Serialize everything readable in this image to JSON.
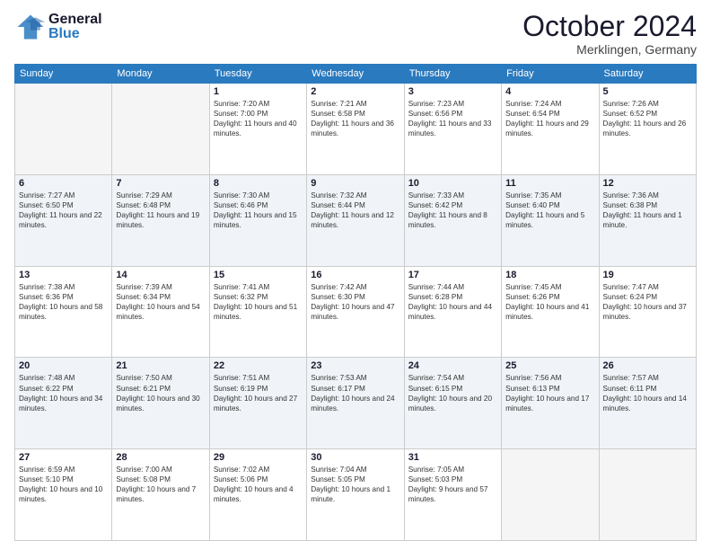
{
  "header": {
    "logo_general": "General",
    "logo_blue": "Blue",
    "month": "October 2024",
    "location": "Merklingen, Germany"
  },
  "weekdays": [
    "Sunday",
    "Monday",
    "Tuesday",
    "Wednesday",
    "Thursday",
    "Friday",
    "Saturday"
  ],
  "weeks": [
    [
      {
        "day": "",
        "sunrise": "",
        "sunset": "",
        "daylight": ""
      },
      {
        "day": "",
        "sunrise": "",
        "sunset": "",
        "daylight": ""
      },
      {
        "day": "1",
        "sunrise": "Sunrise: 7:20 AM",
        "sunset": "Sunset: 7:00 PM",
        "daylight": "Daylight: 11 hours and 40 minutes."
      },
      {
        "day": "2",
        "sunrise": "Sunrise: 7:21 AM",
        "sunset": "Sunset: 6:58 PM",
        "daylight": "Daylight: 11 hours and 36 minutes."
      },
      {
        "day": "3",
        "sunrise": "Sunrise: 7:23 AM",
        "sunset": "Sunset: 6:56 PM",
        "daylight": "Daylight: 11 hours and 33 minutes."
      },
      {
        "day": "4",
        "sunrise": "Sunrise: 7:24 AM",
        "sunset": "Sunset: 6:54 PM",
        "daylight": "Daylight: 11 hours and 29 minutes."
      },
      {
        "day": "5",
        "sunrise": "Sunrise: 7:26 AM",
        "sunset": "Sunset: 6:52 PM",
        "daylight": "Daylight: 11 hours and 26 minutes."
      }
    ],
    [
      {
        "day": "6",
        "sunrise": "Sunrise: 7:27 AM",
        "sunset": "Sunset: 6:50 PM",
        "daylight": "Daylight: 11 hours and 22 minutes."
      },
      {
        "day": "7",
        "sunrise": "Sunrise: 7:29 AM",
        "sunset": "Sunset: 6:48 PM",
        "daylight": "Daylight: 11 hours and 19 minutes."
      },
      {
        "day": "8",
        "sunrise": "Sunrise: 7:30 AM",
        "sunset": "Sunset: 6:46 PM",
        "daylight": "Daylight: 11 hours and 15 minutes."
      },
      {
        "day": "9",
        "sunrise": "Sunrise: 7:32 AM",
        "sunset": "Sunset: 6:44 PM",
        "daylight": "Daylight: 11 hours and 12 minutes."
      },
      {
        "day": "10",
        "sunrise": "Sunrise: 7:33 AM",
        "sunset": "Sunset: 6:42 PM",
        "daylight": "Daylight: 11 hours and 8 minutes."
      },
      {
        "day": "11",
        "sunrise": "Sunrise: 7:35 AM",
        "sunset": "Sunset: 6:40 PM",
        "daylight": "Daylight: 11 hours and 5 minutes."
      },
      {
        "day": "12",
        "sunrise": "Sunrise: 7:36 AM",
        "sunset": "Sunset: 6:38 PM",
        "daylight": "Daylight: 11 hours and 1 minute."
      }
    ],
    [
      {
        "day": "13",
        "sunrise": "Sunrise: 7:38 AM",
        "sunset": "Sunset: 6:36 PM",
        "daylight": "Daylight: 10 hours and 58 minutes."
      },
      {
        "day": "14",
        "sunrise": "Sunrise: 7:39 AM",
        "sunset": "Sunset: 6:34 PM",
        "daylight": "Daylight: 10 hours and 54 minutes."
      },
      {
        "day": "15",
        "sunrise": "Sunrise: 7:41 AM",
        "sunset": "Sunset: 6:32 PM",
        "daylight": "Daylight: 10 hours and 51 minutes."
      },
      {
        "day": "16",
        "sunrise": "Sunrise: 7:42 AM",
        "sunset": "Sunset: 6:30 PM",
        "daylight": "Daylight: 10 hours and 47 minutes."
      },
      {
        "day": "17",
        "sunrise": "Sunrise: 7:44 AM",
        "sunset": "Sunset: 6:28 PM",
        "daylight": "Daylight: 10 hours and 44 minutes."
      },
      {
        "day": "18",
        "sunrise": "Sunrise: 7:45 AM",
        "sunset": "Sunset: 6:26 PM",
        "daylight": "Daylight: 10 hours and 41 minutes."
      },
      {
        "day": "19",
        "sunrise": "Sunrise: 7:47 AM",
        "sunset": "Sunset: 6:24 PM",
        "daylight": "Daylight: 10 hours and 37 minutes."
      }
    ],
    [
      {
        "day": "20",
        "sunrise": "Sunrise: 7:48 AM",
        "sunset": "Sunset: 6:22 PM",
        "daylight": "Daylight: 10 hours and 34 minutes."
      },
      {
        "day": "21",
        "sunrise": "Sunrise: 7:50 AM",
        "sunset": "Sunset: 6:21 PM",
        "daylight": "Daylight: 10 hours and 30 minutes."
      },
      {
        "day": "22",
        "sunrise": "Sunrise: 7:51 AM",
        "sunset": "Sunset: 6:19 PM",
        "daylight": "Daylight: 10 hours and 27 minutes."
      },
      {
        "day": "23",
        "sunrise": "Sunrise: 7:53 AM",
        "sunset": "Sunset: 6:17 PM",
        "daylight": "Daylight: 10 hours and 24 minutes."
      },
      {
        "day": "24",
        "sunrise": "Sunrise: 7:54 AM",
        "sunset": "Sunset: 6:15 PM",
        "daylight": "Daylight: 10 hours and 20 minutes."
      },
      {
        "day": "25",
        "sunrise": "Sunrise: 7:56 AM",
        "sunset": "Sunset: 6:13 PM",
        "daylight": "Daylight: 10 hours and 17 minutes."
      },
      {
        "day": "26",
        "sunrise": "Sunrise: 7:57 AM",
        "sunset": "Sunset: 6:11 PM",
        "daylight": "Daylight: 10 hours and 14 minutes."
      }
    ],
    [
      {
        "day": "27",
        "sunrise": "Sunrise: 6:59 AM",
        "sunset": "Sunset: 5:10 PM",
        "daylight": "Daylight: 10 hours and 10 minutes."
      },
      {
        "day": "28",
        "sunrise": "Sunrise: 7:00 AM",
        "sunset": "Sunset: 5:08 PM",
        "daylight": "Daylight: 10 hours and 7 minutes."
      },
      {
        "day": "29",
        "sunrise": "Sunrise: 7:02 AM",
        "sunset": "Sunset: 5:06 PM",
        "daylight": "Daylight: 10 hours and 4 minutes."
      },
      {
        "day": "30",
        "sunrise": "Sunrise: 7:04 AM",
        "sunset": "Sunset: 5:05 PM",
        "daylight": "Daylight: 10 hours and 1 minute."
      },
      {
        "day": "31",
        "sunrise": "Sunrise: 7:05 AM",
        "sunset": "Sunset: 5:03 PM",
        "daylight": "Daylight: 9 hours and 57 minutes."
      },
      {
        "day": "",
        "sunrise": "",
        "sunset": "",
        "daylight": ""
      },
      {
        "day": "",
        "sunrise": "",
        "sunset": "",
        "daylight": ""
      }
    ]
  ]
}
